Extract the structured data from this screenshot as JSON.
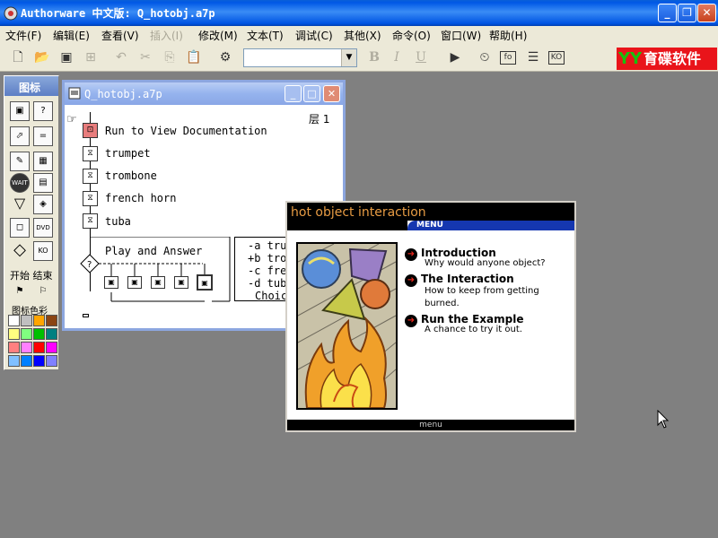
{
  "window": {
    "title": "Authorware 中文版: Q_hotobj.a7p",
    "controls": [
      "minimize",
      "maximize",
      "close"
    ]
  },
  "menubar": {
    "items": [
      {
        "label": "文件(F)",
        "enabled": true
      },
      {
        "label": "编辑(E)",
        "enabled": true
      },
      {
        "label": "查看(V)",
        "enabled": true
      },
      {
        "label": "插入(I)",
        "enabled": false
      },
      {
        "label": "修改(M)",
        "enabled": true
      },
      {
        "label": "文本(T)",
        "enabled": true
      },
      {
        "label": "调试(C)",
        "enabled": true
      },
      {
        "label": "其他(X)",
        "enabled": true
      },
      {
        "label": "命令(O)",
        "enabled": true
      },
      {
        "label": "窗口(W)",
        "enabled": true
      },
      {
        "label": "帮助(H)",
        "enabled": true
      }
    ]
  },
  "toolbar": {
    "font_value": "",
    "bold_label": "B",
    "italic_label": "I",
    "underline_label": "U"
  },
  "brand": {
    "logo": "YY",
    "text": "育碟软件"
  },
  "palette": {
    "title": "图标",
    "start_label": "开始",
    "end_label": "结束",
    "color_label": "图标色彩",
    "colors": [
      "#ffffff",
      "#c0c0c0",
      "#ffa500",
      "#8b4513",
      "#ffff80",
      "#80ff80",
      "#00c000",
      "#008080",
      "#ff8080",
      "#ff80ff",
      "#ff0000",
      "#ff00ff",
      "#80c0ff",
      "#0080ff",
      "#0000ff",
      "#8080ff"
    ]
  },
  "flow_window": {
    "title": "Q_hotobj.a7p",
    "layer_label": "层 1",
    "icons": [
      {
        "label": "Run to View Documentation"
      },
      {
        "label": "trumpet"
      },
      {
        "label": "trombone"
      },
      {
        "label": "french horn"
      },
      {
        "label": "tuba"
      }
    ],
    "interaction_label": "Play and Answer",
    "choices": [
      "-a tru",
      "+b tro",
      "-c fre",
      "-d tub",
      "Choic"
    ]
  },
  "presentation": {
    "header": "hot object interaction",
    "menu_tab": "MENU",
    "footer": "menu",
    "items": [
      {
        "title": "Introduction",
        "subtitle": [
          "Why would anyone object?"
        ]
      },
      {
        "title": "The Interaction",
        "subtitle": [
          "How to keep from getting",
          "burned."
        ]
      },
      {
        "title": "Run the Example",
        "subtitle": [
          "A chance to try it out."
        ]
      }
    ]
  }
}
